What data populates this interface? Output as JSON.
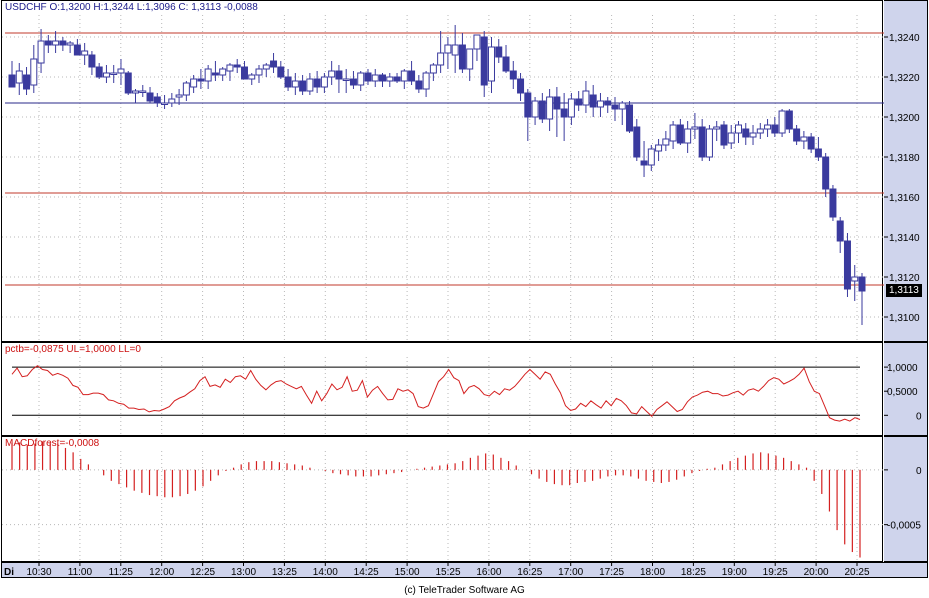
{
  "colors": {
    "candle": "#3a3a9e",
    "hline_red": "#c0392b",
    "hline_blue": "#2a2a8a",
    "indicator": "#d42020",
    "axis_bg": "#cfd4ec",
    "grid": "#b8b8b8"
  },
  "price_pane": {
    "title": "USDCHF O:1,3200 H:1,3244 L:1,3096 C: 1,3113 -0,0088",
    "last_price_label": "1,3113"
  },
  "pctb_pane": {
    "title": "pctb=-0,0875 UL=1,0000 LL=0"
  },
  "macd_pane": {
    "title": "MACDforest=-0,0008"
  },
  "x_axis": {
    "day_label": "Di",
    "ticks": [
      "10:30",
      "11:00",
      "11:25",
      "12:00",
      "12:25",
      "13:00",
      "13:25",
      "14:00",
      "14:25",
      "15:00",
      "15:25",
      "16:00",
      "16:25",
      "17:00",
      "17:25",
      "18:00",
      "18:25",
      "19:00",
      "19:25",
      "20:00",
      "20:25"
    ]
  },
  "footer": "(c) TeleTrader Software AG",
  "chart_data": [
    {
      "type": "candlestick",
      "title": "USDCHF O:1,3200 H:1,3244 L:1,3096 C: 1,3113 -0,0088",
      "ylim": [
        1.309,
        1.325
      ],
      "y_ticks": [
        "1,3240",
        "1,3220",
        "1,3200",
        "1,3180",
        "1,3160",
        "1,3140",
        "1,3120",
        "1,3100"
      ],
      "horizontal_lines": [
        1.3242,
        1.3207,
        1.3162,
        1.3116
      ],
      "candles": [
        [
          1.3221,
          1.3228,
          1.3215,
          1.3215
        ],
        [
          1.3217,
          1.3227,
          1.3211,
          1.3223
        ],
        [
          1.3221,
          1.3225,
          1.3211,
          1.3214
        ],
        [
          1.3216,
          1.3236,
          1.3212,
          1.3229
        ],
        [
          1.3227,
          1.3244,
          1.3222,
          1.3238
        ],
        [
          1.3238,
          1.3241,
          1.3232,
          1.3236
        ],
        [
          1.3236,
          1.3243,
          1.3232,
          1.3238
        ],
        [
          1.3238,
          1.324,
          1.3233,
          1.3236
        ],
        [
          1.3236,
          1.3238,
          1.3232,
          1.3237
        ],
        [
          1.3236,
          1.3239,
          1.3231,
          1.3231
        ],
        [
          1.3231,
          1.3237,
          1.3226,
          1.3233
        ],
        [
          1.3231,
          1.3233,
          1.3221,
          1.3225
        ],
        [
          1.3225,
          1.3227,
          1.3219,
          1.322
        ],
        [
          1.322,
          1.3226,
          1.3217,
          1.3222
        ],
        [
          1.3222,
          1.3226,
          1.3217,
          1.3222
        ],
        [
          1.3222,
          1.3229,
          1.3216,
          1.3224
        ],
        [
          1.3222,
          1.3223,
          1.3211,
          1.3212
        ],
        [
          1.3212,
          1.3214,
          1.3207,
          1.3213
        ],
        [
          1.3213,
          1.3216,
          1.321,
          1.3213
        ],
        [
          1.3212,
          1.3215,
          1.3207,
          1.3208
        ],
        [
          1.321,
          1.3212,
          1.3205,
          1.3207
        ],
        [
          1.3207,
          1.3211,
          1.3204,
          1.3207
        ],
        [
          1.3207,
          1.3212,
          1.3205,
          1.3209
        ],
        [
          1.321,
          1.3214,
          1.3206,
          1.3211
        ],
        [
          1.3211,
          1.3218,
          1.3208,
          1.3217
        ],
        [
          1.3215,
          1.3221,
          1.3212,
          1.3219
        ],
        [
          1.3219,
          1.3224,
          1.3214,
          1.3218
        ],
        [
          1.3218,
          1.3226,
          1.3214,
          1.3224
        ],
        [
          1.3222,
          1.3228,
          1.3218,
          1.3221
        ],
        [
          1.3221,
          1.3225,
          1.3218,
          1.3224
        ],
        [
          1.3223,
          1.3227,
          1.3218,
          1.3226
        ],
        [
          1.3226,
          1.3229,
          1.3222,
          1.3225
        ],
        [
          1.3225,
          1.3228,
          1.3219,
          1.3219
        ],
        [
          1.3219,
          1.3222,
          1.3216,
          1.3221
        ],
        [
          1.3221,
          1.3226,
          1.3217,
          1.3224
        ],
        [
          1.3224,
          1.3227,
          1.322,
          1.3226
        ],
        [
          1.3228,
          1.3232,
          1.3222,
          1.3225
        ],
        [
          1.3225,
          1.3228,
          1.3219,
          1.322
        ],
        [
          1.322,
          1.3224,
          1.3213,
          1.3215
        ],
        [
          1.3215,
          1.3222,
          1.3211,
          1.3218
        ],
        [
          1.3218,
          1.3221,
          1.3211,
          1.3213
        ],
        [
          1.3213,
          1.3222,
          1.3211,
          1.3219
        ],
        [
          1.3219,
          1.3223,
          1.3212,
          1.3215
        ],
        [
          1.3215,
          1.3222,
          1.3212,
          1.322
        ],
        [
          1.322,
          1.3228,
          1.3216,
          1.3223
        ],
        [
          1.3223,
          1.3226,
          1.3212,
          1.3219
        ],
        [
          1.3219,
          1.3224,
          1.3212,
          1.3219
        ],
        [
          1.3219,
          1.3223,
          1.3214,
          1.3216
        ],
        [
          1.3216,
          1.3223,
          1.3213,
          1.3222
        ],
        [
          1.3222,
          1.3224,
          1.3216,
          1.3218
        ],
        [
          1.3218,
          1.3224,
          1.3215,
          1.3221
        ],
        [
          1.3221,
          1.3222,
          1.3215,
          1.3218
        ],
        [
          1.3218,
          1.3222,
          1.3215,
          1.322
        ],
        [
          1.322,
          1.3222,
          1.3217,
          1.3218
        ],
        [
          1.3218,
          1.3224,
          1.3214,
          1.3223
        ],
        [
          1.3223,
          1.3228,
          1.3216,
          1.3218
        ],
        [
          1.3218,
          1.3221,
          1.3212,
          1.3214
        ],
        [
          1.3214,
          1.3223,
          1.321,
          1.3222
        ],
        [
          1.3222,
          1.3227,
          1.3218,
          1.3226
        ],
        [
          1.3226,
          1.3243,
          1.3222,
          1.3232
        ],
        [
          1.3232,
          1.324,
          1.3224,
          1.3236
        ],
        [
          1.3231,
          1.3246,
          1.3222,
          1.3236
        ],
        [
          1.3236,
          1.3242,
          1.3222,
          1.3224
        ],
        [
          1.3224,
          1.3233,
          1.3218,
          1.3234
        ],
        [
          1.3234,
          1.324,
          1.3228,
          1.3241
        ],
        [
          1.324,
          1.3243,
          1.321,
          1.3216
        ],
        [
          1.3218,
          1.324,
          1.3212,
          1.3235
        ],
        [
          1.3235,
          1.3239,
          1.3227,
          1.323
        ],
        [
          1.323,
          1.3236,
          1.3222,
          1.3223
        ],
        [
          1.3223,
          1.3228,
          1.3214,
          1.3219
        ],
        [
          1.3219,
          1.3222,
          1.3208,
          1.3212
        ],
        [
          1.3212,
          1.3214,
          1.3188,
          1.32
        ],
        [
          1.32,
          1.321,
          1.3196,
          1.3208
        ],
        [
          1.3208,
          1.3212,
          1.3197,
          1.3199
        ],
        [
          1.3199,
          1.3214,
          1.3193,
          1.321
        ],
        [
          1.321,
          1.3215,
          1.319,
          1.3204
        ],
        [
          1.3204,
          1.3212,
          1.3188,
          1.32
        ],
        [
          1.32,
          1.3212,
          1.3196,
          1.3209
        ],
        [
          1.3209,
          1.3213,
          1.3203,
          1.3206
        ],
        [
          1.3206,
          1.3218,
          1.3202,
          1.3213
        ],
        [
          1.3211,
          1.3216,
          1.32,
          1.3205
        ],
        [
          1.3205,
          1.3212,
          1.32,
          1.3208
        ],
        [
          1.3208,
          1.321,
          1.3202,
          1.3206
        ],
        [
          1.3206,
          1.321,
          1.3198,
          1.3204
        ],
        [
          1.3204,
          1.3208,
          1.3196,
          1.3207
        ],
        [
          1.3206,
          1.3208,
          1.3192,
          1.3193
        ],
        [
          1.3195,
          1.3199,
          1.3178,
          1.318
        ],
        [
          1.3178,
          1.3188,
          1.317,
          1.3176
        ],
        [
          1.3176,
          1.3186,
          1.3173,
          1.3184
        ],
        [
          1.3183,
          1.3189,
          1.3178,
          1.3186
        ],
        [
          1.3186,
          1.3193,
          1.3183,
          1.3189
        ],
        [
          1.3188,
          1.3198,
          1.3184,
          1.3196
        ],
        [
          1.3196,
          1.3199,
          1.3186,
          1.3187
        ],
        [
          1.3187,
          1.3198,
          1.3182,
          1.3194
        ],
        [
          1.3194,
          1.3202,
          1.3189,
          1.3195
        ],
        [
          1.3195,
          1.3199,
          1.3178,
          1.318
        ],
        [
          1.318,
          1.3196,
          1.3178,
          1.3194
        ],
        [
          1.3194,
          1.3198,
          1.3188,
          1.3195
        ],
        [
          1.3196,
          1.3198,
          1.3184,
          1.3186
        ],
        [
          1.3187,
          1.3196,
          1.3184,
          1.3192
        ],
        [
          1.3192,
          1.3198,
          1.3187,
          1.3196
        ],
        [
          1.3194,
          1.3197,
          1.3186,
          1.319
        ],
        [
          1.319,
          1.3196,
          1.3186,
          1.3192
        ],
        [
          1.3192,
          1.3197,
          1.3189,
          1.3194
        ],
        [
          1.3194,
          1.3199,
          1.319,
          1.3196
        ],
        [
          1.3196,
          1.32,
          1.319,
          1.3192
        ],
        [
          1.3192,
          1.3204,
          1.319,
          1.3203
        ],
        [
          1.3203,
          1.3204,
          1.3192,
          1.3194
        ],
        [
          1.3194,
          1.3196,
          1.3186,
          1.3188
        ],
        [
          1.3188,
          1.3193,
          1.3184,
          1.319
        ],
        [
          1.319,
          1.3192,
          1.3182,
          1.3184
        ],
        [
          1.3184,
          1.319,
          1.3178,
          1.318
        ],
        [
          1.318,
          1.3182,
          1.316,
          1.3164
        ],
        [
          1.3164,
          1.3166,
          1.3148,
          1.315
        ],
        [
          1.3148,
          1.315,
          1.3132,
          1.3138
        ],
        [
          1.3138,
          1.3142,
          1.311,
          1.3114
        ],
        [
          1.3118,
          1.3126,
          1.3108,
          1.312
        ],
        [
          1.312,
          1.3122,
          1.3096,
          1.3113
        ]
      ]
    },
    {
      "type": "line",
      "title": "pctb=-0,0875 UL=1,0000 LL=0",
      "ylim": [
        -0.45,
        1.5
      ],
      "y_ticks": [
        "1,0000",
        "0,5000",
        "0"
      ],
      "reference_lines": [
        1.0,
        0.0
      ],
      "values": [
        0.85,
        0.98,
        0.8,
        0.82,
        0.95,
        1.03,
        0.95,
        0.93,
        0.83,
        0.87,
        0.83,
        0.77,
        0.62,
        0.58,
        0.43,
        0.43,
        0.46,
        0.46,
        0.43,
        0.32,
        0.3,
        0.25,
        0.23,
        0.15,
        0.15,
        0.12,
        0.13,
        0.07,
        0.1,
        0.09,
        0.13,
        0.18,
        0.3,
        0.36,
        0.4,
        0.48,
        0.55,
        0.72,
        0.8,
        0.6,
        0.63,
        0.58,
        0.75,
        0.68,
        0.8,
        0.82,
        0.75,
        0.93,
        0.75,
        0.62,
        0.53,
        0.63,
        0.7,
        0.72,
        0.65,
        0.6,
        0.55,
        0.6,
        0.42,
        0.25,
        0.5,
        0.3,
        0.45,
        0.65,
        0.53,
        0.58,
        0.8,
        0.5,
        0.52,
        0.72,
        0.38,
        0.52,
        0.6,
        0.45,
        0.32,
        0.33,
        0.55,
        0.5,
        0.53,
        0.45,
        0.18,
        0.15,
        0.2,
        0.45,
        0.7,
        0.8,
        0.95,
        0.78,
        0.72,
        0.45,
        0.58,
        0.62,
        0.55,
        0.43,
        0.4,
        0.5,
        0.43,
        0.55,
        0.52,
        0.6,
        0.72,
        0.85,
        0.95,
        0.85,
        0.75,
        0.9,
        0.85,
        0.65,
        0.47,
        0.2,
        0.1,
        0.13,
        0.25,
        0.18,
        0.3,
        0.22,
        0.15,
        0.3,
        0.2,
        0.35,
        0.3,
        0.2,
        0.05,
        0.03,
        0.18,
        0.08,
        -0.02,
        0.12,
        0.2,
        0.28,
        0.18,
        0.08,
        0.12,
        0.28,
        0.38,
        0.42,
        0.48,
        0.5,
        0.45,
        0.45,
        0.4,
        0.42,
        0.47,
        0.5,
        0.42,
        0.52,
        0.55,
        0.5,
        0.6,
        0.72,
        0.78,
        0.75,
        0.65,
        0.7,
        0.76,
        0.85,
        0.98,
        0.7,
        0.5,
        0.45,
        0.2,
        -0.05,
        -0.1,
        -0.12,
        -0.08,
        -0.12,
        -0.05,
        -0.0875
      ]
    },
    {
      "type": "bar",
      "title": "MACDforest=-0,0008",
      "ylim": [
        -0.00085,
        0.0003
      ],
      "y_ticks": [
        "0",
        "-0,0005"
      ],
      "values": [
        0.00025,
        0.00025,
        0.00023,
        0.00024,
        0.00026,
        0.00025,
        0.00024,
        0.0002,
        0.00016,
        0.0001,
        5e-05,
        0.0,
        -5e-05,
        -0.0001,
        -0.00013,
        -0.00016,
        -0.00019,
        -0.00021,
        -0.00023,
        -0.00024,
        -0.00025,
        -0.00025,
        -0.00024,
        -0.00022,
        -0.00019,
        -0.00015,
        -0.0001,
        -5e-05,
        -1e-05,
        2e-05,
        5e-05,
        7e-05,
        8e-05,
        8e-05,
        8e-05,
        7e-05,
        6e-05,
        5e-05,
        4e-05,
        2e-05,
        0.0,
        -1e-05,
        -3e-05,
        -4e-05,
        -5e-05,
        -6e-05,
        -6e-05,
        -6e-05,
        -5e-05,
        -4e-05,
        -3e-05,
        -2e-05,
        0.0,
        1e-05,
        2e-05,
        3e-05,
        4e-05,
        5e-05,
        6e-05,
        8e-05,
        0.00011,
        0.00013,
        0.00015,
        0.00014,
        0.00011,
        8e-05,
        4e-05,
        0.0,
        -4e-05,
        -8e-05,
        -0.00011,
        -0.00013,
        -0.00014,
        -0.00014,
        -0.00012,
        -0.00011,
        -0.0001,
        -8e-05,
        -6e-05,
        -5e-05,
        -5e-05,
        -6e-05,
        -8e-05,
        -0.0001,
        -0.00011,
        -0.00012,
        -0.00011,
        -9e-05,
        -6e-05,
        -3e-05,
        -1e-05,
        1e-05,
        2e-05,
        5e-05,
        8e-05,
        0.00011,
        0.00013,
        0.00015,
        0.00016,
        0.00015,
        0.00013,
        0.00011,
        8e-05,
        5e-05,
        2e-05,
        -0.0001,
        -0.00022,
        -0.00038,
        -0.00055,
        -0.00068,
        -0.00075,
        -0.0008
      ]
    }
  ]
}
